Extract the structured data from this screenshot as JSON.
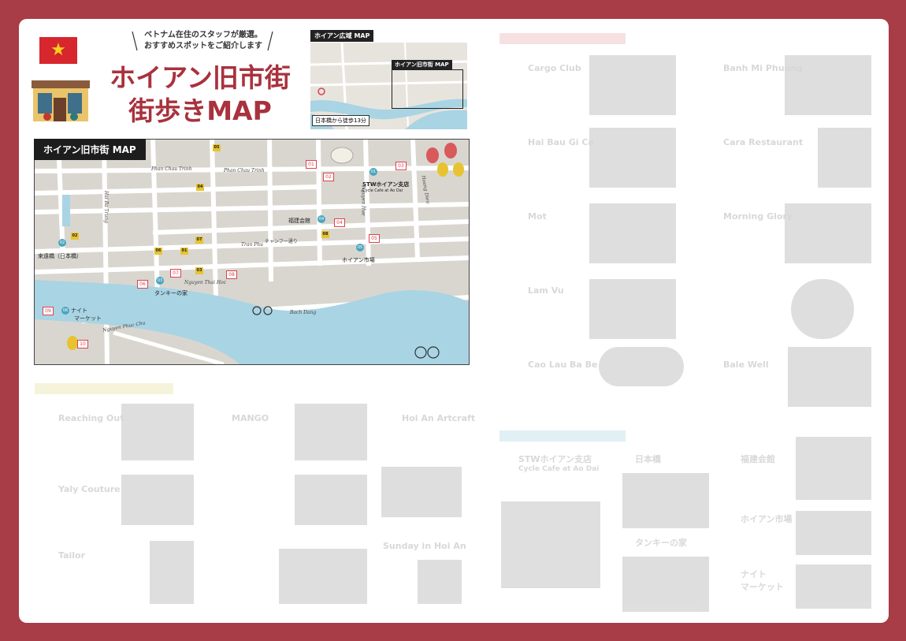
{
  "header": {
    "tagline_1": "ベトナム在住のスタッフが厳選。",
    "tagline_2": "おすすめスポットをご紹介します",
    "title_1": "ホイアン旧市街",
    "title_2": "街歩きMAP"
  },
  "wide_map": {
    "label": "ホイアン広域 MAP",
    "old_town_label": "ホイアン旧市街 MAP",
    "walk_note": "日本橋から徒歩13分"
  },
  "old_town_map": {
    "label": "ホイアン旧市街 MAP",
    "streets": [
      "Phan Chau Trinh",
      "Phan Chau Trinh",
      "Hai Ba Trung",
      "Tran Phu",
      "チャンフー通り",
      "Nguyen Thai Hoc",
      "Bach Dang",
      "Nguyen Phuc Chu",
      "Nguyen Hue",
      "Hoang Dieu"
    ],
    "places": [
      "STWホイアン支店",
      "Cycle Cafe at Ao Dai",
      "福建会館",
      "来遠橋（日本橋）",
      "ホイアン市場",
      "タンキーの家",
      "ナイト",
      "マーケット"
    ],
    "pins": [
      "01",
      "02",
      "03",
      "04",
      "05",
      "06"
    ],
    "spots": [
      "05",
      "04",
      "02",
      "07",
      "06",
      "01",
      "03",
      "08"
    ],
    "eats": [
      "01",
      "02",
      "03",
      "04",
      "05",
      "06",
      "07",
      "08",
      "09",
      "10"
    ],
    "colors": {
      "river": "#a9d4e4",
      "land": "#d9d6d0",
      "road": "#ffffff",
      "accent": "#a8323d"
    }
  },
  "faded_right": {
    "names": [
      "Cargo Club",
      "Banh Mi Phuong",
      "Hai Bau Gi Ca",
      "Cara Restaurant",
      "Mot",
      "Morning Glory",
      "Lam Vu",
      "Cao Lau Ba Be",
      "Bale Well"
    ],
    "sights": [
      "STWホイアン支店",
      "Cycle Cafe at Ao Dai",
      "日本橋",
      "福建会館",
      "ホイアン市場",
      "タンキーの家",
      "ナイト",
      "マーケット"
    ]
  },
  "faded_left": {
    "names": [
      "Reaching Out",
      "MANGO",
      "Hoi An Artcraft",
      "Yaly Couture",
      "Tailor",
      "Sunday in Hoi An"
    ]
  }
}
